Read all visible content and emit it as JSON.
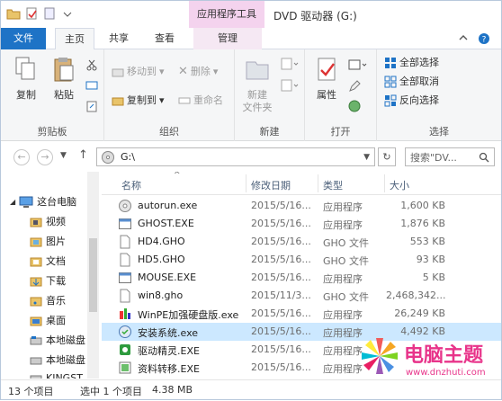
{
  "window": {
    "title": "DVD 驱动器 (G:)",
    "context_tab": "应用程序工具"
  },
  "menu": {
    "file": "文件",
    "home": "主页",
    "share": "共享",
    "view": "查看",
    "manage": "管理"
  },
  "ribbon": {
    "clipboard": {
      "label": "剪贴板",
      "copy": "复制",
      "paste": "粘贴"
    },
    "organize": {
      "label": "组织",
      "move_to": "移动到",
      "copy_to": "复制到",
      "delete": "删除",
      "rename": "重命名"
    },
    "new": {
      "label": "新建",
      "new_folder_line1": "新建",
      "new_folder_line2": "文件夹"
    },
    "open": {
      "label": "打开",
      "properties": "属性"
    },
    "select": {
      "label": "选择",
      "select_all": "全部选择",
      "select_none": "全部取消",
      "invert": "反向选择"
    }
  },
  "address": {
    "path": "G:\\",
    "search_placeholder": "搜索\"DV..."
  },
  "sidebar": {
    "items": [
      "这台电脑",
      "视频",
      "图片",
      "文档",
      "下载",
      "音乐",
      "桌面",
      "本地磁盘",
      "本地磁盘",
      "KINGST"
    ]
  },
  "columns": {
    "name": "名称",
    "date": "修改日期",
    "type": "类型",
    "size": "大小"
  },
  "files": [
    {
      "name": "autorun.exe",
      "date": "2015/5/16...",
      "type": "应用程序",
      "size": "1,600 KB",
      "icon": "cd-icon"
    },
    {
      "name": "GHOST.EXE",
      "date": "2015/5/16...",
      "type": "应用程序",
      "size": "1,876 KB",
      "icon": "app-icon"
    },
    {
      "name": "HD4.GHO",
      "date": "2015/5/16...",
      "type": "GHO 文件",
      "size": "553 KB",
      "icon": "file-icon"
    },
    {
      "name": "HD5.GHO",
      "date": "2015/5/16...",
      "type": "GHO 文件",
      "size": "93 KB",
      "icon": "file-icon"
    },
    {
      "name": "MOUSE.EXE",
      "date": "2015/5/16...",
      "type": "应用程序",
      "size": "5 KB",
      "icon": "app-icon"
    },
    {
      "name": "win8.gho",
      "date": "2015/11/3...",
      "type": "GHO 文件",
      "size": "2,468,342...",
      "icon": "file-icon"
    },
    {
      "name": "WinPE加强硬盘版.exe",
      "date": "2015/5/16...",
      "type": "应用程序",
      "size": "26,249 KB",
      "icon": "pe-icon"
    },
    {
      "name": "安装系统.exe",
      "date": "2015/5/16...",
      "type": "应用程序",
      "size": "4,492 KB",
      "icon": "install-icon"
    },
    {
      "name": "驱动精灵.EXE",
      "date": "2015/5/16...",
      "type": "应用程序",
      "size": "",
      "icon": "driver-icon"
    },
    {
      "name": "资料转移.EXE",
      "date": "2015/5/16...",
      "type": "应用程序",
      "size": "",
      "icon": "transfer-icon"
    }
  ],
  "status": {
    "count": "13 个项目",
    "selected": "选中 1 个项目",
    "size": "4.38 MB"
  },
  "watermark": {
    "text": "电脑主题",
    "url": "www.dnzhuti.com"
  },
  "colors": {
    "accent": "#1e73c6",
    "context": "#f4d3ee",
    "selection": "#cce8ff"
  }
}
